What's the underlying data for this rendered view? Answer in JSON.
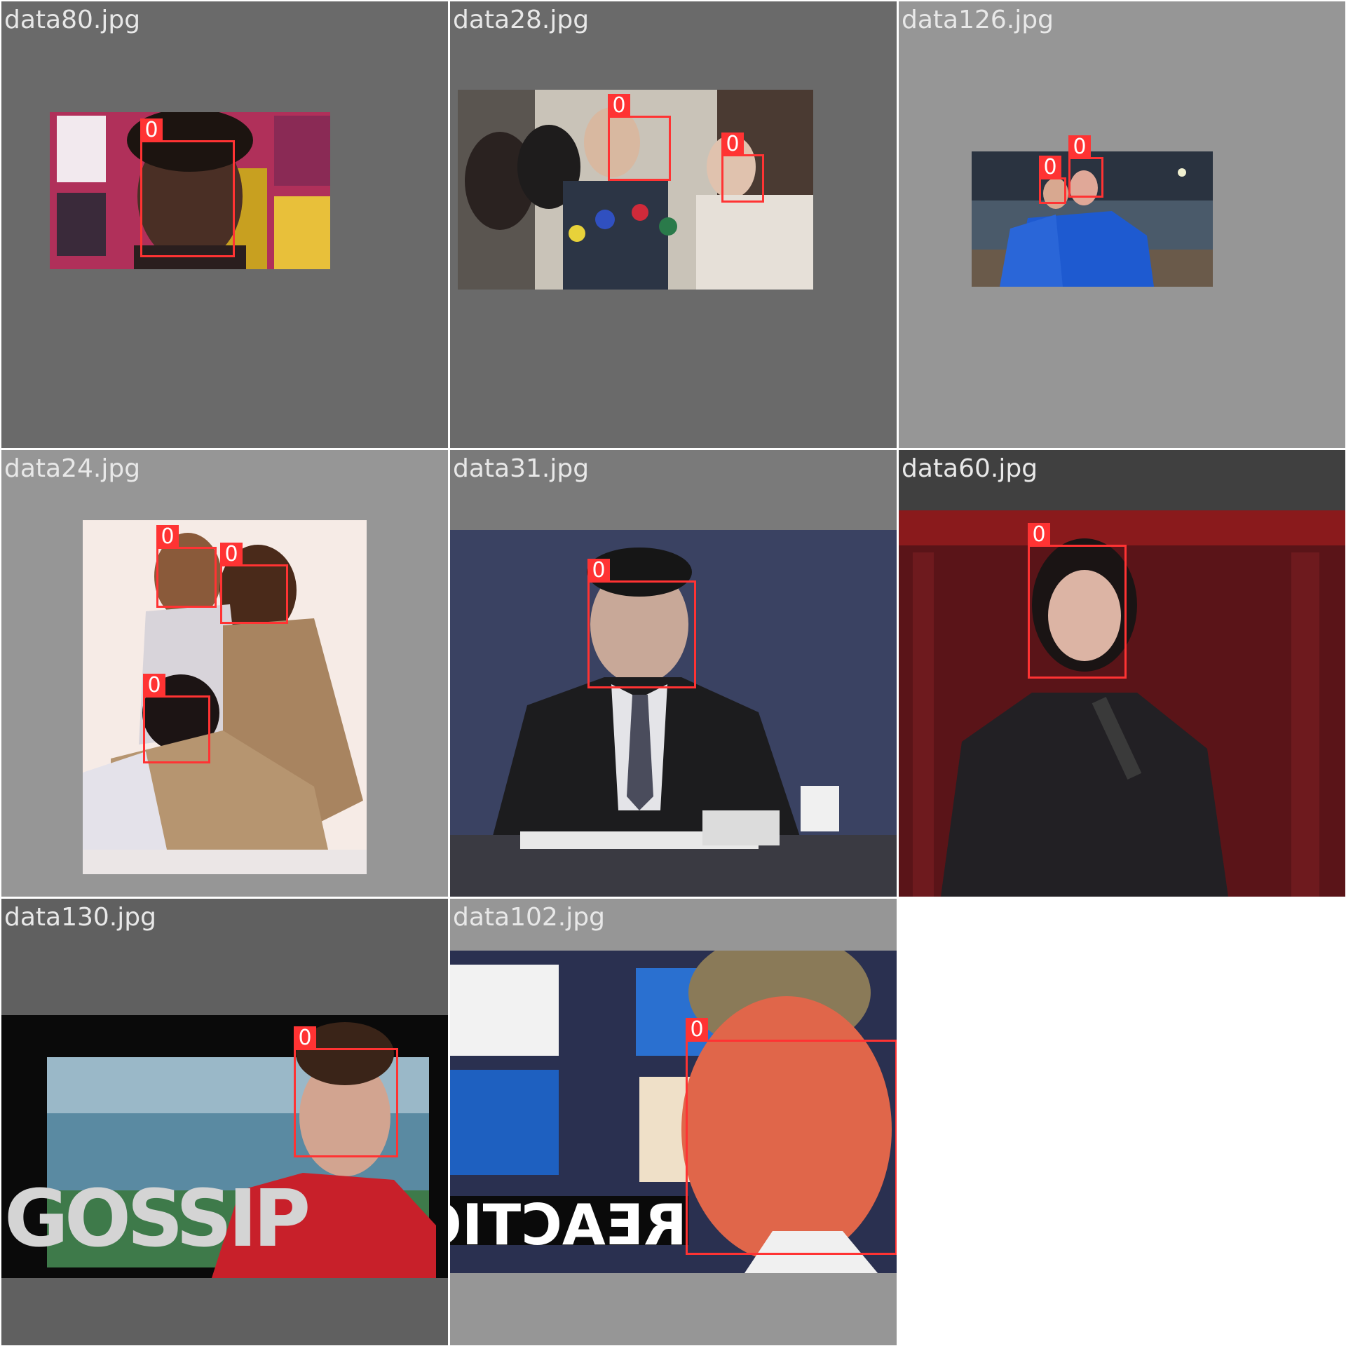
{
  "colors": {
    "box": "#ff3333",
    "label_text": "#e8e8e8"
  },
  "tiles": [
    {
      "filename": "data80.jpg",
      "class_label": "0"
    },
    {
      "filename": "data28.jpg",
      "class_label": "0"
    },
    {
      "filename": "data126.jpg",
      "class_label": "0"
    },
    {
      "filename": "data24.jpg",
      "class_label": "0"
    },
    {
      "filename": "data31.jpg",
      "class_label": "0"
    },
    {
      "filename": "data60.jpg",
      "class_label": "0"
    },
    {
      "filename": "data130.jpg",
      "class_label": "0",
      "overlay_text": "GOSSIP"
    },
    {
      "filename": "data102.jpg",
      "class_label": "0",
      "overlay_text": "REACTION"
    }
  ]
}
